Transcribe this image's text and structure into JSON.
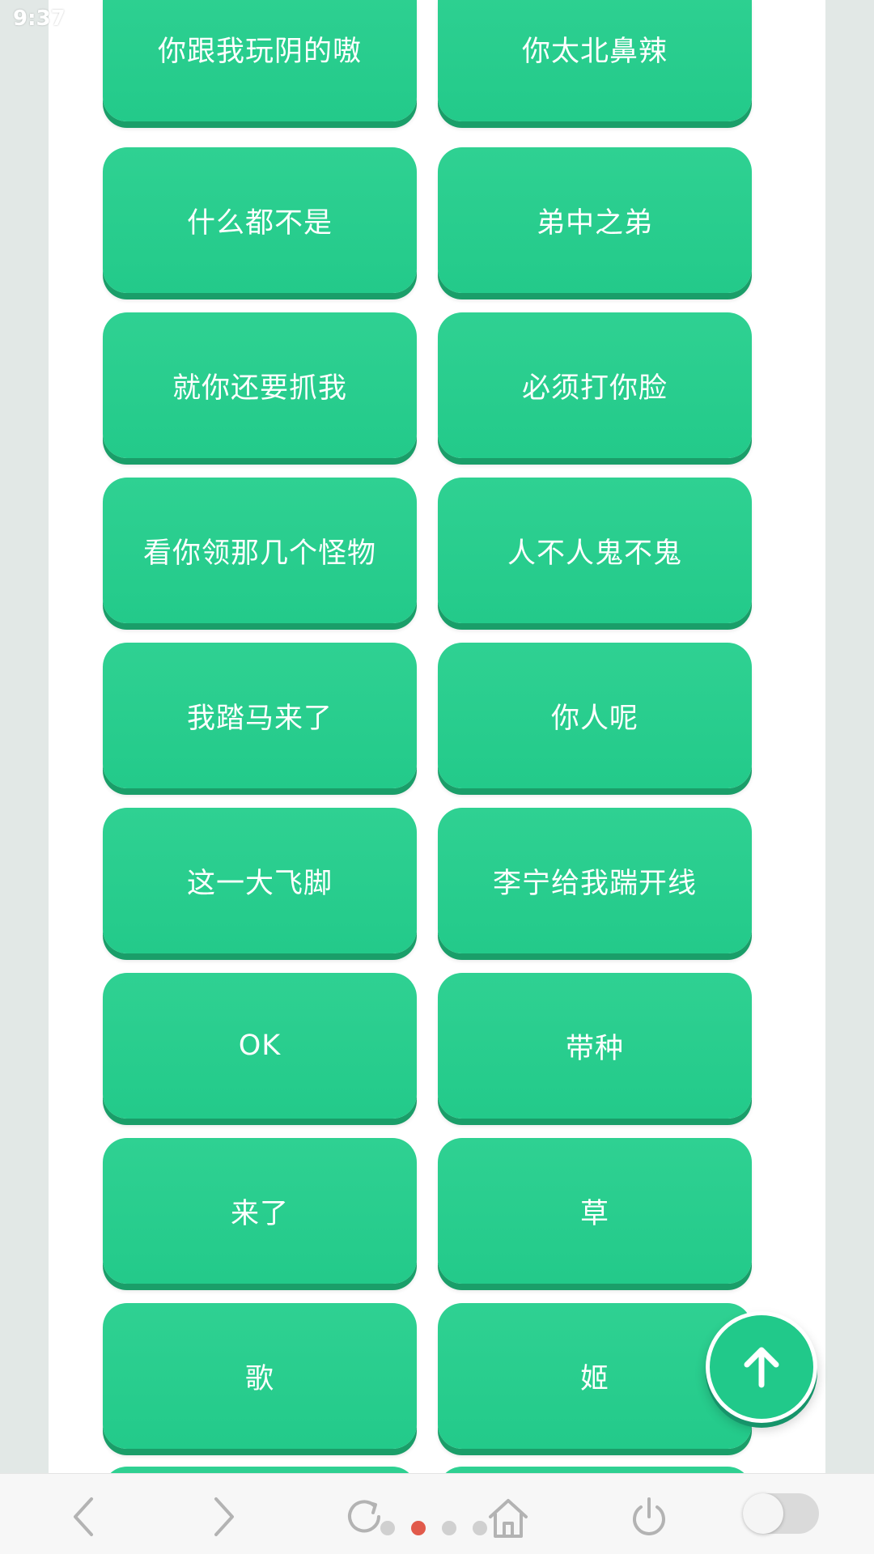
{
  "status_bar": {
    "time": "9:37"
  },
  "buttons": [
    {
      "label": "你跟我玩阴的嗷"
    },
    {
      "label": "你太北鼻辣"
    },
    {
      "label": "什么都不是"
    },
    {
      "label": "弟中之弟"
    },
    {
      "label": "就你还要抓我"
    },
    {
      "label": "必须打你脸"
    },
    {
      "label": "看你领那几个怪物"
    },
    {
      "label": "人不人鬼不鬼"
    },
    {
      "label": "我踏马来了"
    },
    {
      "label": "你人呢"
    },
    {
      "label": "这一大飞脚"
    },
    {
      "label": "李宁给我踹开线"
    },
    {
      "label": "OK"
    },
    {
      "label": "带种"
    },
    {
      "label": "来了"
    },
    {
      "label": "草"
    },
    {
      "label": "歌"
    },
    {
      "label": "姬"
    }
  ],
  "fab": {
    "icon": "arrow-up-icon"
  },
  "browser_nav": {
    "items": [
      "back-icon",
      "forward-icon",
      "refresh-icon",
      "home-icon",
      "power-icon"
    ],
    "page_indicator": {
      "total": 4,
      "active": 2
    },
    "toggle_on": false
  },
  "colors": {
    "button_green": "#23ca8a",
    "button_shadow": "#1a9e69",
    "side_background": "#e2e8e6",
    "active_dot": "#e15a4b"
  }
}
